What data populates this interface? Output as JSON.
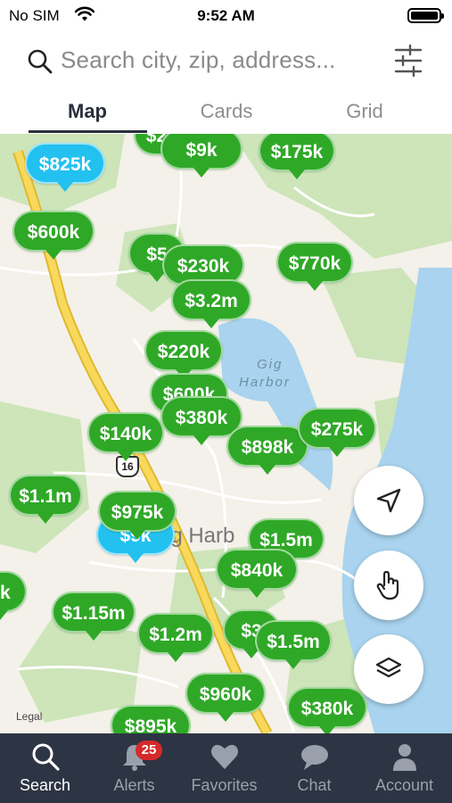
{
  "status_bar": {
    "carrier": "No SIM",
    "time": "9:52 AM"
  },
  "search": {
    "placeholder": "Search city, zip, address..."
  },
  "tabs": [
    {
      "label": "Map",
      "active": true
    },
    {
      "label": "Cards",
      "active": false
    },
    {
      "label": "Grid",
      "active": false
    }
  ],
  "map": {
    "water_label": "Gig\nHarbor",
    "town_label": "ig Harb",
    "route_shield": "16",
    "legal": "Legal",
    "colors": {
      "pin_green": "#2fa827",
      "pin_blue": "#22c1f0",
      "water": "#a9d3ee",
      "park": "#c9e3b4",
      "highway": "#f5cf45"
    },
    "pins": [
      {
        "price": "$220k",
        "color": "green"
      },
      {
        "price": "$9k",
        "color": "green"
      },
      {
        "price": "$175k",
        "color": "green"
      },
      {
        "price": "$825k",
        "color": "blue"
      },
      {
        "price": "$600k",
        "color": "green"
      },
      {
        "price": "$5",
        "color": "green"
      },
      {
        "price": "$230k",
        "color": "green"
      },
      {
        "price": "$770k",
        "color": "green"
      },
      {
        "price": "$3.2m",
        "color": "green"
      },
      {
        "price": "$220k",
        "color": "green"
      },
      {
        "price": "$600k",
        "color": "green"
      },
      {
        "price": "$380k",
        "color": "green"
      },
      {
        "price": "$140k",
        "color": "green"
      },
      {
        "price": "$898k",
        "color": "green"
      },
      {
        "price": "$275k",
        "color": "green"
      },
      {
        "price": "$1.1m",
        "color": "green"
      },
      {
        "price": "$9k",
        "color": "blue"
      },
      {
        "price": "$975k",
        "color": "green"
      },
      {
        "price": "$1.5m",
        "color": "green"
      },
      {
        "price": "$840k",
        "color": "green"
      },
      {
        "price": "0k",
        "color": "green"
      },
      {
        "price": "$1.15m",
        "color": "green"
      },
      {
        "price": "$1.2m",
        "color": "green"
      },
      {
        "price": "$3",
        "color": "green"
      },
      {
        "price": "$1.5m",
        "color": "green"
      },
      {
        "price": "$960k",
        "color": "green"
      },
      {
        "price": "$380k",
        "color": "green"
      },
      {
        "price": "$895k",
        "color": "green"
      }
    ]
  },
  "nav": [
    {
      "label": "Search",
      "icon": "search-icon",
      "active": true
    },
    {
      "label": "Alerts",
      "icon": "bell-icon",
      "badge": "25"
    },
    {
      "label": "Favorites",
      "icon": "heart-icon"
    },
    {
      "label": "Chat",
      "icon": "chat-icon"
    },
    {
      "label": "Account",
      "icon": "person-icon"
    }
  ]
}
